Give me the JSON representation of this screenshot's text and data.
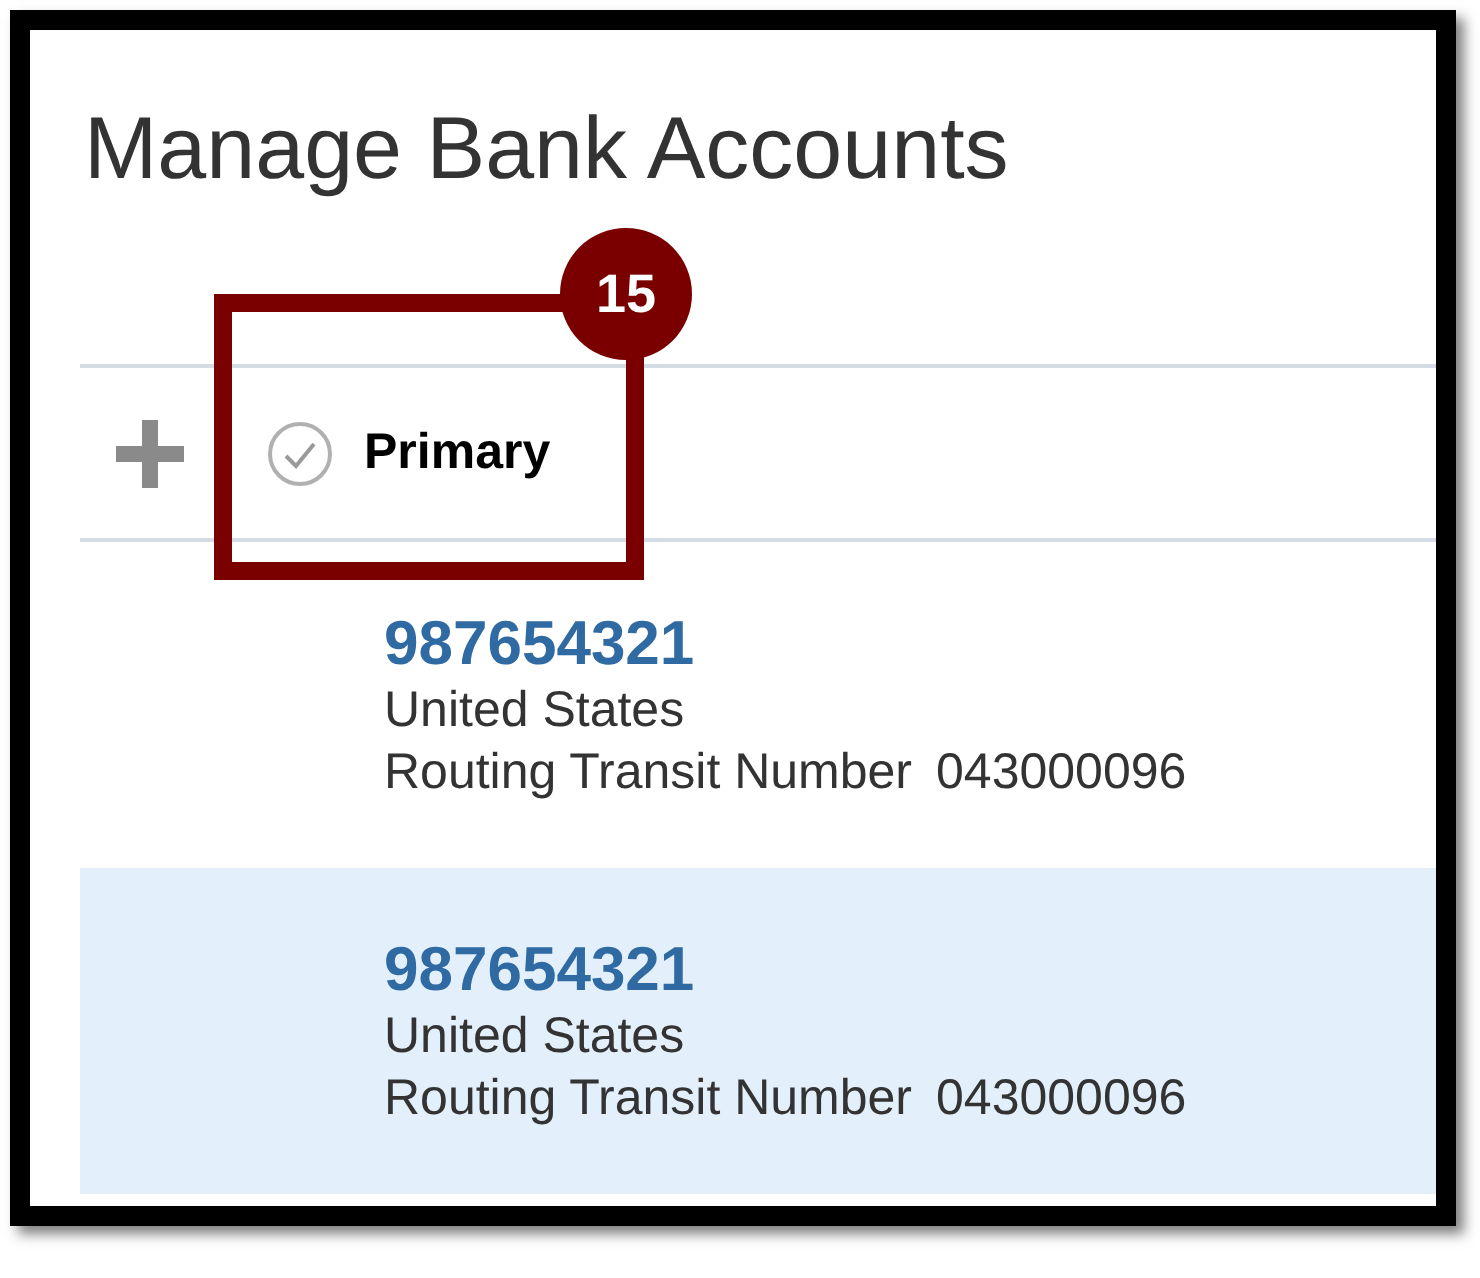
{
  "page": {
    "title": "Manage Bank Accounts"
  },
  "toolbar": {
    "primary_label": "Primary"
  },
  "accounts": [
    {
      "number": "987654321",
      "country": "United States",
      "routing_label": "Routing Transit Number",
      "routing_number": "043000096",
      "selected": false
    },
    {
      "number": "987654321",
      "country": "United States",
      "routing_label": "Routing Transit Number",
      "routing_number": "043000096",
      "selected": true
    }
  ],
  "callout": {
    "number": "15"
  }
}
